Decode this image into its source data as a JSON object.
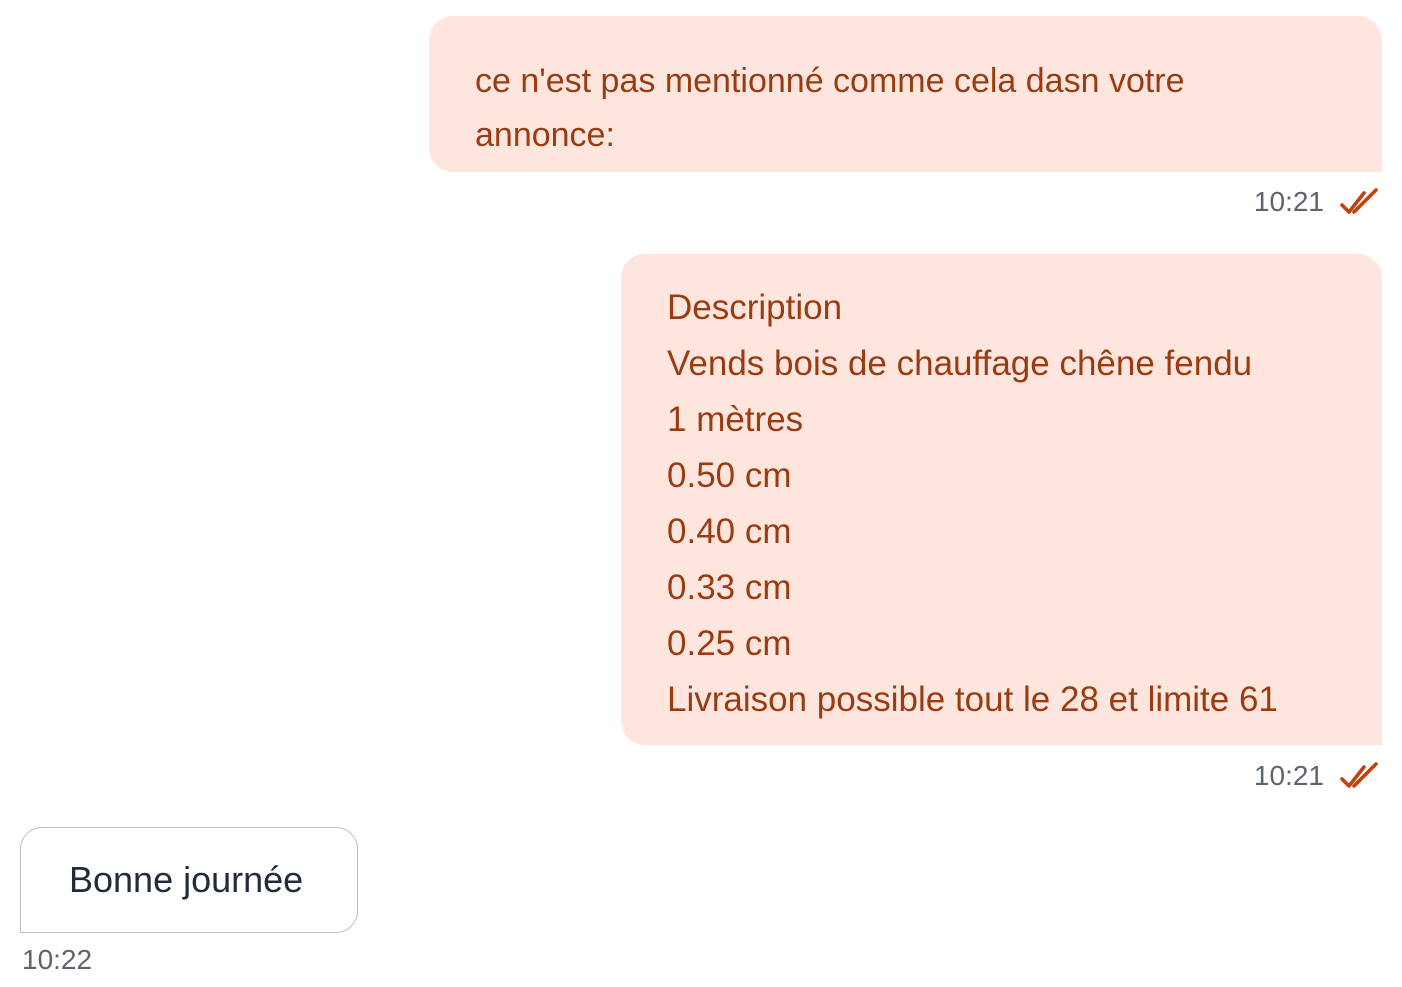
{
  "messages": [
    {
      "direction": "outgoing",
      "lines": [
        "ce n'est pas mentionné comme cela dasn votre",
        "annonce:"
      ],
      "time": "10:21",
      "status_icon": "double-check-icon"
    },
    {
      "direction": "outgoing",
      "lines": [
        "Description",
        "Vends bois de chauffage chêne fendu",
        "1 mètres",
        "0.50 cm",
        "0.40 cm",
        "0.33 cm",
        "0.25 cm",
        "Livraison possible tout le 28 et limite 61"
      ],
      "time": "10:21",
      "status_icon": "double-check-icon"
    },
    {
      "direction": "incoming",
      "text": "Bonne journée",
      "time": "10:22"
    }
  ],
  "colors": {
    "outgoing_bg": "#fee6de",
    "outgoing_text": "#9a3c12",
    "check_color": "#c2410c",
    "incoming_text": "#222b3a",
    "meta_text": "#5d6470"
  }
}
